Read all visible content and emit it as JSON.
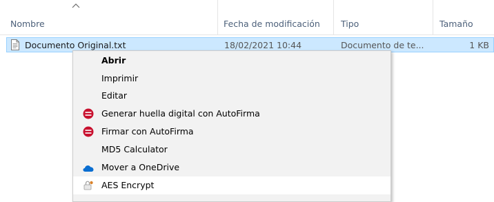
{
  "columns": [
    {
      "label": "Nombre"
    },
    {
      "label": "Fecha de modificación"
    },
    {
      "label": "Tipo"
    },
    {
      "label": "Tamaño"
    }
  ],
  "file": {
    "name": "Documento Original.txt",
    "modified": "18/02/2021 10:44",
    "type": "Documento de te...",
    "size": "1 KB",
    "icon": "text-document-icon"
  },
  "context_menu": {
    "items": [
      {
        "label": "Abrir",
        "bold": true
      },
      {
        "label": "Imprimir"
      },
      {
        "label": "Editar"
      },
      {
        "label": "Generar huella digital con AutoFirma",
        "icon": "autofirma-icon"
      },
      {
        "label": "Firmar con AutoFirma",
        "icon": "autofirma-icon"
      },
      {
        "label": "MD5 Calculator"
      },
      {
        "label": "Mover a OneDrive",
        "icon": "onedrive-cloud-icon"
      },
      {
        "label": "AES Encrypt",
        "icon": "aes-crypt-icon"
      }
    ]
  },
  "colors": {
    "selection_bg": "#cce8ff",
    "selection_border": "#99d1ff",
    "header_text": "#4c607a",
    "autofirma_red": "#c8102e",
    "onedrive_blue": "#0a6ed1"
  }
}
